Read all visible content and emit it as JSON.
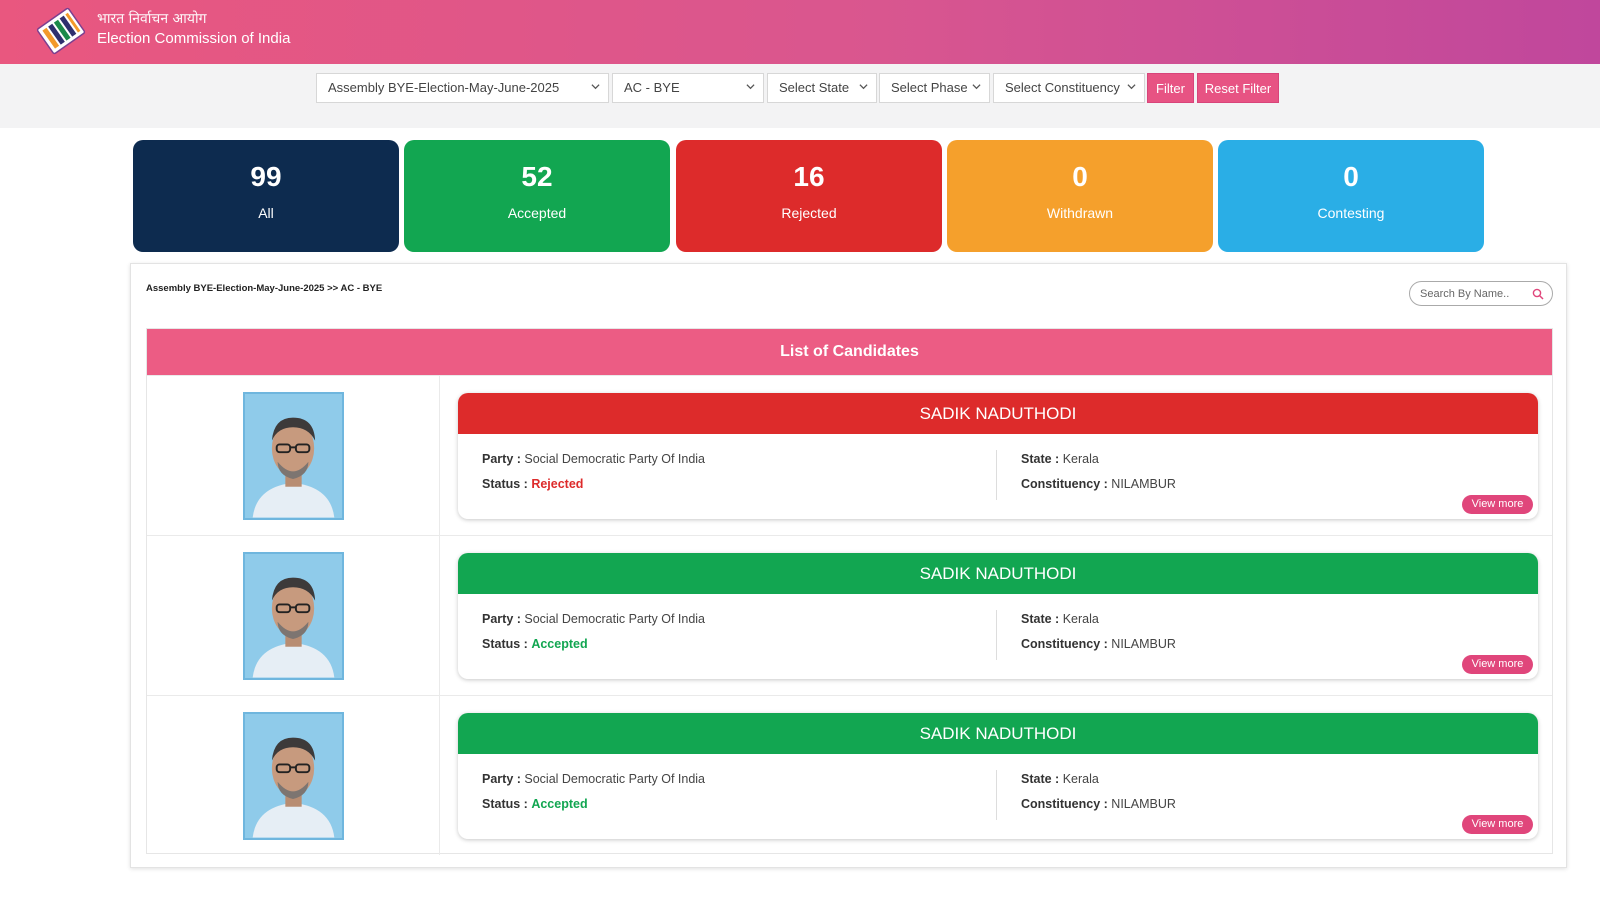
{
  "header": {
    "title_hindi": "भारत निर्वाचन आयोग",
    "title_english": "Election Commission of India",
    "gradient_from": "#e9577f",
    "gradient_to": "#c0479c"
  },
  "filters": {
    "election": "Assembly BYE-Election-May-June-2025",
    "election_type": "AC - BYE",
    "state": "Select State",
    "phase": "Select Phase",
    "constituency": "Select Constituency",
    "filter_label": "Filter",
    "reset_label": "Reset Filter"
  },
  "stats": [
    {
      "count": "99",
      "label": "All",
      "color": "#0d2b4f"
    },
    {
      "count": "52",
      "label": "Accepted",
      "color": "#12a651"
    },
    {
      "count": "16",
      "label": "Rejected",
      "color": "#dd2b2b"
    },
    {
      "count": "0",
      "label": "Withdrawn",
      "color": "#f5a02c"
    },
    {
      "count": "0",
      "label": "Contesting",
      "color": "#2aaee6"
    }
  ],
  "panel": {
    "breadcrumb": "Assembly BYE-Election-May-June-2025 >> AC - BYE",
    "search_placeholder": "Search By Name..",
    "list_title": "List of Candidates"
  },
  "labels": {
    "party": "Party :",
    "status": "Status :",
    "state": "State :",
    "constituency": "Constituency :",
    "view_more": "View more"
  },
  "candidates": [
    {
      "name": "SADIK NADUTHODI",
      "party": "Social Democratic Party Of India",
      "status": "Rejected",
      "status_color": "#dd2b2b",
      "state": "Kerala",
      "constituency": "NILAMBUR"
    },
    {
      "name": "SADIK NADUTHODI",
      "party": "Social Democratic Party Of India",
      "status": "Accepted",
      "status_color": "#12a651",
      "state": "Kerala",
      "constituency": "NILAMBUR"
    },
    {
      "name": "SADIK NADUTHODI",
      "party": "Social Democratic Party Of India",
      "status": "Accepted",
      "status_color": "#12a651",
      "state": "Kerala",
      "constituency": "NILAMBUR"
    }
  ]
}
